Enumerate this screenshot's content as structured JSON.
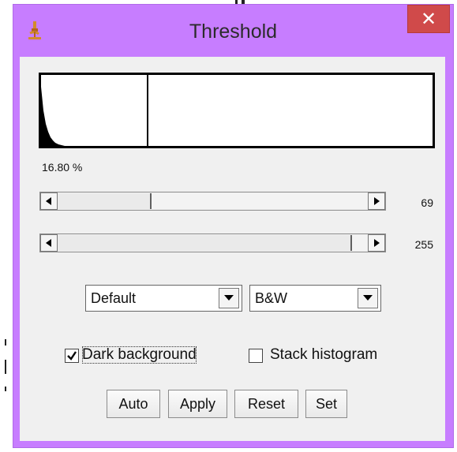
{
  "window": {
    "title": "Threshold",
    "close_label": "✕",
    "app_icon": "microscope-icon"
  },
  "histogram": {
    "percent_label": "16.80 %",
    "threshold_fraction": 0.27
  },
  "sliders": [
    {
      "name": "lower",
      "value": "69",
      "min": 0,
      "max": 255,
      "current": 69
    },
    {
      "name": "upper",
      "value": "255",
      "min": 0,
      "max": 255,
      "current": 255
    }
  ],
  "dropdowns": {
    "method": {
      "selected": "Default"
    },
    "display": {
      "selected": "B&W"
    }
  },
  "checkboxes": {
    "dark_background": {
      "label": "Dark background",
      "checked": true
    },
    "stack_histogram": {
      "label": "Stack histogram",
      "checked": false
    }
  },
  "buttons": {
    "auto": "Auto",
    "apply": "Apply",
    "reset": "Reset",
    "set": "Set"
  },
  "colors": {
    "titlebar": "#c77dff",
    "close_button": "#d04a4a",
    "panel": "#f0f0f0"
  }
}
